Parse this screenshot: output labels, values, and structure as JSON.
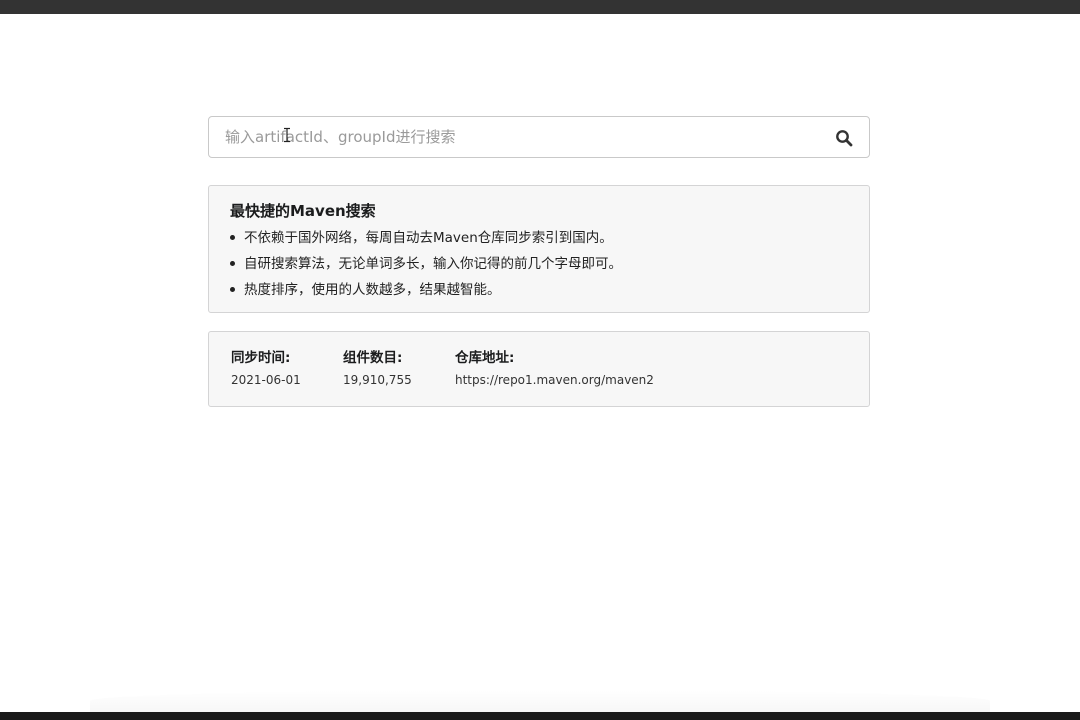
{
  "search": {
    "placeholder": "输入artifactId、groupId进行搜索",
    "value": ""
  },
  "intro": {
    "title": "最快捷的Maven搜索",
    "features": [
      "不依赖于国外网络，每周自动去Maven仓库同步索引到国内。",
      "自研搜索算法，无论单词多长，输入你记得的前几个字母即可。",
      "热度排序，使用的人数越多，结果越智能。"
    ]
  },
  "stats": {
    "sync_label": "同步时间:",
    "sync_value": "2021-06-01",
    "count_label": "组件数目:",
    "count_value": "19,910,755",
    "repo_label": "仓库地址:",
    "repo_value": "https://repo1.maven.org/maven2"
  },
  "icons": {
    "search": "search-icon",
    "cursor": "text-cursor-icon"
  },
  "colors": {
    "card_background": "#f7f7f7",
    "card_border": "#d4d4d5",
    "input_border": "#c9c9c9",
    "top_bar": "#333333"
  }
}
